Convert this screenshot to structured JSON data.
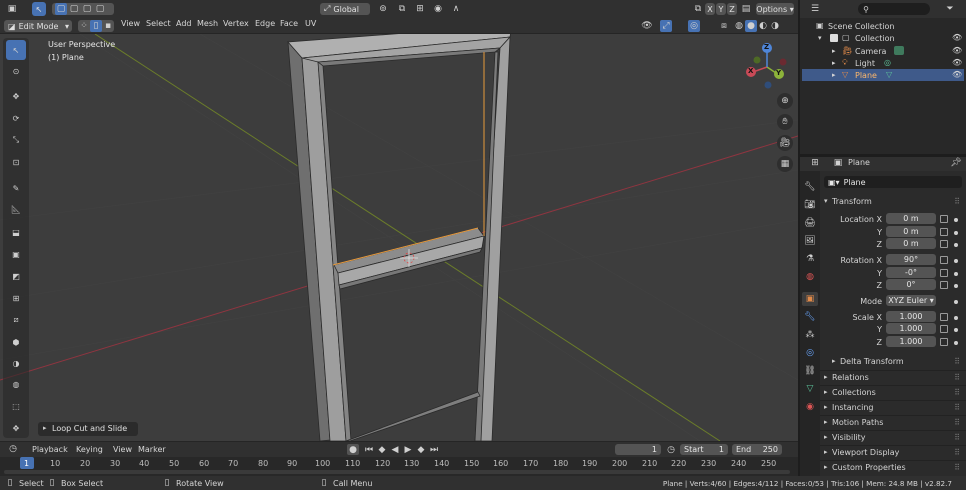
{
  "header": {
    "orientation": "Global",
    "xyz": [
      "X",
      "Y",
      "Z"
    ],
    "options": "Options",
    "mode": "Edit Mode",
    "menus": [
      "View",
      "Select",
      "Add",
      "Mesh",
      "Vertex",
      "Edge",
      "Face",
      "UV"
    ]
  },
  "viewport": {
    "perspective": "User Perspective",
    "object": "(1) Plane",
    "gizmo": {
      "x": "X",
      "y": "Y",
      "z": "Z"
    },
    "last_op": "Loop Cut and Slide"
  },
  "outliner": {
    "search_placeholder": "",
    "scene": "Scene Collection",
    "collection": "Collection",
    "items": [
      {
        "name": "Camera"
      },
      {
        "name": "Light"
      },
      {
        "name": "Plane"
      }
    ]
  },
  "properties": {
    "crumb": "Plane",
    "object_name": "Plane",
    "transform_title": "Transform",
    "location_label": "Location X",
    "rotation_label": "Rotation X",
    "scale_label": "Scale X",
    "y_label": "Y",
    "z_label": "Z",
    "location": [
      "0 m",
      "0 m",
      "0 m"
    ],
    "rotation": [
      "90°",
      "-0°",
      "0°"
    ],
    "mode_label": "Mode",
    "mode_value": "XYZ Euler",
    "scale": [
      "1.000",
      "1.000",
      "1.000"
    ],
    "delta": "Delta Transform",
    "sections": [
      "Relations",
      "Collections",
      "Instancing",
      "Motion Paths",
      "Visibility",
      "Viewport Display",
      "Custom Properties"
    ]
  },
  "timeline": {
    "menus": [
      "Playback",
      "Keying",
      "View",
      "Marker"
    ],
    "current_frame": "1",
    "start_label": "Start",
    "start": "1",
    "end_label": "End",
    "end": "250",
    "ticks": [
      "1",
      "10",
      "20",
      "30",
      "40",
      "50",
      "60",
      "70",
      "80",
      "90",
      "100",
      "110",
      "120",
      "130",
      "140",
      "150",
      "160",
      "170",
      "180",
      "190",
      "200",
      "210",
      "220",
      "230",
      "240",
      "250"
    ]
  },
  "statusbar": {
    "select": "Select",
    "box_select": "Box Select",
    "rotate_view": "Rotate View",
    "call_menu": "Call Menu",
    "stats": "Plane | Verts:4/60 | Edges:4/112 | Faces:0/53 | Tris:106 | Mem: 24.8 MB | v2.82.7"
  },
  "colors": {
    "accent": "#4772b3",
    "grid_red": "#a3363f",
    "grid_green": "#6b8a2a",
    "selected_edge": "#e89a3c"
  }
}
